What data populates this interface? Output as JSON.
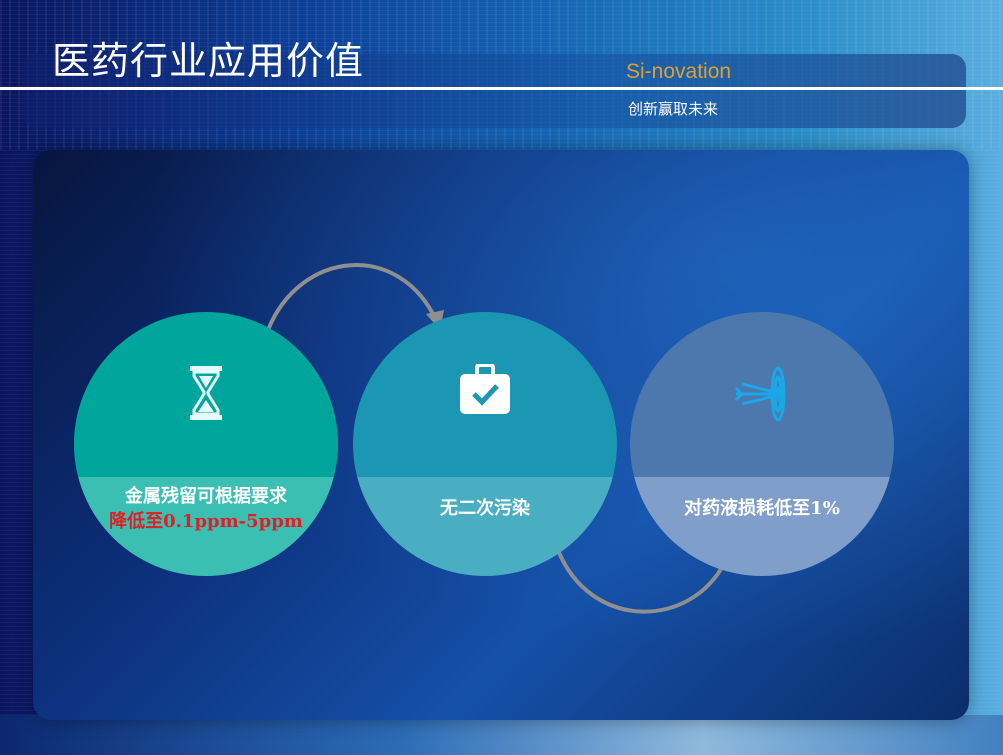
{
  "header": {
    "title": "医药行业应用价值",
    "brand_name": "Si-novation",
    "brand_slogan": "创新赢取未来"
  },
  "items": [
    {
      "line1": "金属残留可根据要求",
      "line2": "降低至0.1ppm-5ppm",
      "icon": "hourglass-icon",
      "color": "#00a69c",
      "highlight_color": "#e01e24"
    },
    {
      "line1": "无二次污染",
      "icon": "briefcase-check-icon",
      "color": "#1b96b3"
    },
    {
      "line1": "对药液损耗低至1%",
      "icon": "target-arrows-icon",
      "color": "#4c78ad"
    }
  ]
}
